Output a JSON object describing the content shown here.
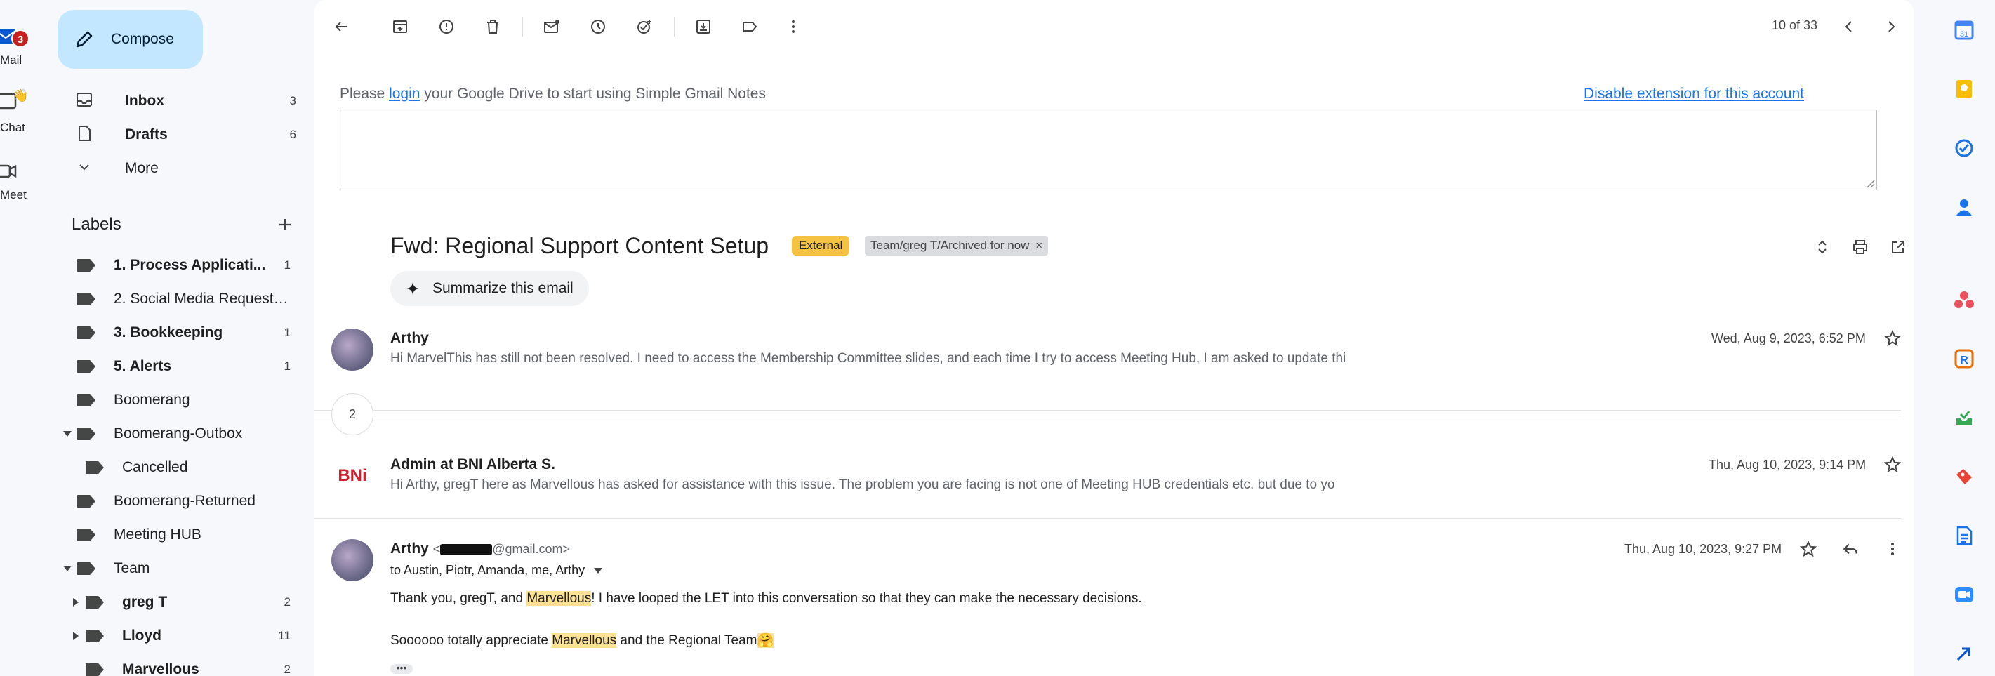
{
  "rail": {
    "mail_label": "Mail",
    "mail_badge": "3",
    "chat_label": "Chat",
    "meet_label": "Meet"
  },
  "sidebar": {
    "compose_label": "Compose",
    "nav": [
      {
        "label": "Inbox",
        "count": "3",
        "icon": "inbox-icon"
      },
      {
        "label": "Drafts",
        "count": "6",
        "icon": "draft-icon"
      },
      {
        "label": "More",
        "count": "",
        "icon": "chevron-down-icon"
      }
    ],
    "labels_title": "Labels",
    "labels": [
      {
        "label": "1. Process Applicati...",
        "count": "1",
        "bold": true
      },
      {
        "label": "2. Social Media Requests...",
        "count": "",
        "bold": false
      },
      {
        "label": "3. Bookkeeping",
        "count": "1",
        "bold": true
      },
      {
        "label": "5. Alerts",
        "count": "1",
        "bold": true
      },
      {
        "label": "Boomerang",
        "count": "",
        "bold": false
      },
      {
        "label": "Boomerang-Outbox",
        "count": "",
        "bold": false
      },
      {
        "label": "Cancelled",
        "count": "",
        "bold": false
      },
      {
        "label": "Boomerang-Returned",
        "count": "",
        "bold": false
      },
      {
        "label": "Meeting HUB",
        "count": "",
        "bold": false
      },
      {
        "label": "Team",
        "count": "",
        "bold": false
      },
      {
        "label": "greg T",
        "count": "2",
        "bold": true
      },
      {
        "label": "Lloyd",
        "count": "11",
        "bold": true
      },
      {
        "label": "Marvellous",
        "count": "2",
        "bold": true
      }
    ]
  },
  "toolbar": {
    "pager": "10 of 33"
  },
  "notes": {
    "prefix": "Please",
    "link": "login",
    "suffix": "your Google Drive to start using Simple Gmail Notes",
    "disable": "Disable extension for this account"
  },
  "thread": {
    "subject": "Fwd: Regional Support Content Setup",
    "chip_external": "External",
    "chip_label": "Team/greg T/Archived for now",
    "chip_label_close": "×",
    "summarize": "Summarize this email",
    "collapsed_count": "2",
    "messages": [
      {
        "sender": "Arthy",
        "snippet": "Hi MarvelThis has still not been resolved. I need to access the Membership Committee slides, and each time I try to access Meeting Hub, I am asked to update thi",
        "date": "Wed, Aug 9, 2023, 6:52 PM"
      },
      {
        "sender": "Admin at BNI Alberta S.",
        "snippet": "Hi Arthy, gregT here as Marvellous has asked for assistance with this issue. The problem you are facing is not one of Meeting HUB credentials etc. but due to yo",
        "date": "Thu, Aug 10, 2023, 9:14 PM",
        "avatar_text": "BNi"
      },
      {
        "sender": "Arthy",
        "email_prefix": "<",
        "email_suffix": "@gmail.com>",
        "to": "to Austin, Piotr, Amanda, me, Arthy",
        "date": "Thu, Aug 10, 2023, 9:27 PM",
        "line1_a": "Thank you, gregT, and ",
        "line1_hl": "Marvellous",
        "line1_b": "! I have looped the LET into this conversation so that they can make the necessary decisions.",
        "line2_a": "Soooooo totally appreciate ",
        "line2_hl": "Marvellous",
        "line2_b": " and the Regional Team",
        "line2_emoji": "🤗",
        "dots": "•••"
      }
    ]
  },
  "colors": {
    "compose_bg": "#c2e7ff",
    "external_chip": "#f5c242",
    "highlight": "#fde293",
    "badge": "#c5221f",
    "link": "#1a73e8"
  }
}
